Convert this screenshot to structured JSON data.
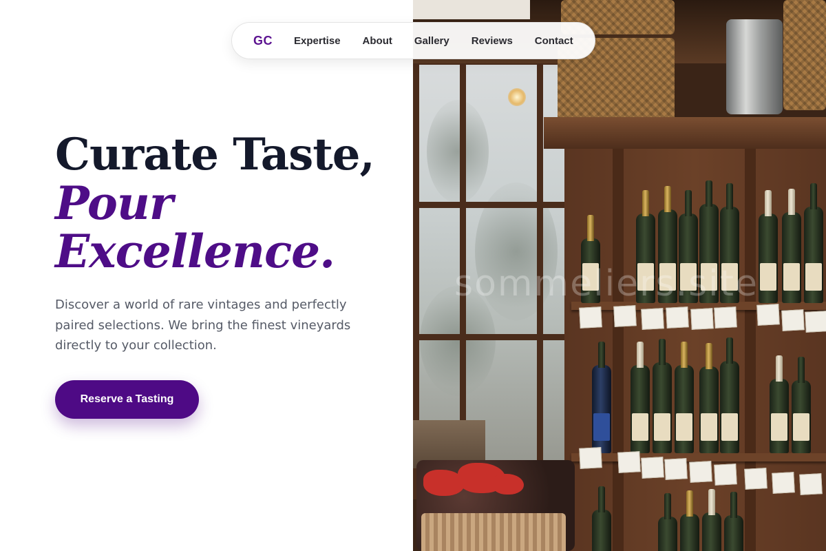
{
  "nav": {
    "logo": "GC",
    "links": [
      "Expertise",
      "About",
      "Gallery",
      "Reviews",
      "Contact"
    ]
  },
  "hero": {
    "headline_line1": "Curate Taste,",
    "headline_line2": "Pour",
    "headline_line3": "Excellence.",
    "subtitle": "Discover a world of rare vintages and perfectly paired selections. We bring the finest vineyards directly to your collection.",
    "cta_label": "Reserve a Tasting"
  },
  "image": {
    "watermark": "sommeliers.site"
  },
  "colors": {
    "brand_purple": "#4e0a85",
    "heading_dark": "#14192b",
    "body_gray": "#555a66"
  }
}
